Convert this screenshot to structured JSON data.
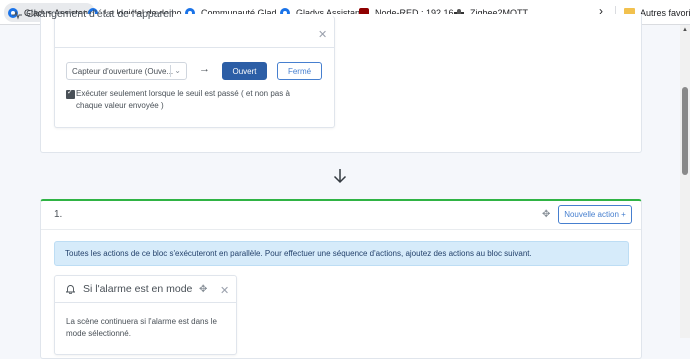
{
  "bookmarks": {
    "items": [
      {
        "label": "Gladys Assistant",
        "icon": "gladys-icon"
      },
      {
        "label": "Le logiciel de domo...",
        "icon": "gladys-icon"
      },
      {
        "label": "Communauté Glad...",
        "icon": "gladys-icon"
      },
      {
        "label": "Gladys Assistant",
        "icon": "gladys-icon"
      },
      {
        "label": "Node-RED : 192.16...",
        "icon": "node-red-icon"
      },
      {
        "label": "Zigbee2MQTT",
        "icon": "zigbee-icon"
      }
    ],
    "more_icon": "chevron-right-icon",
    "other_favorites": "Autres favoris"
  },
  "trigger_card": {
    "title": "Changement d'état de l'appareil",
    "icon": "activity-icon",
    "device_select": "Capteur d'ouverture (Ouve...",
    "open_button": "Ouvert",
    "closed_button": "Fermé",
    "threshold_checked": true,
    "threshold_label": "Exécuter seulement lorsque le seuil est passé ( et non pas à chaque valeur envoyée )"
  },
  "action_block": {
    "number": "1.",
    "new_action_button": "Nouvelle action +",
    "info_alert": "Toutes les actions de ce bloc s'exécuteront en parallèle. Pour effectuer une séquence d'actions, ajoutez des actions au bloc suivant.",
    "alarm_card": {
      "title": "Si l'alarme est en mode",
      "icon": "bell-icon",
      "description": "La scène continuera si l'alarme est dans le mode sélectionné."
    }
  },
  "colors": {
    "primary": "#2c5ea6",
    "outline": "#467fcf",
    "success": "#2fb344",
    "alert_bg": "#d6ebfa"
  }
}
